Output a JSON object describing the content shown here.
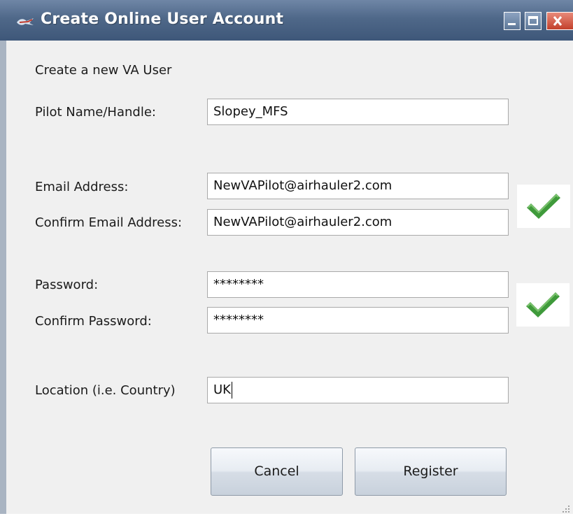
{
  "window": {
    "title": "Create Online User Account"
  },
  "form": {
    "heading": "Create a new VA User",
    "pilot_name": {
      "label": "Pilot Name/Handle:",
      "value": "Slopey_MFS"
    },
    "email": {
      "label": "Email Address:",
      "value": "NewVAPilot@airhauler2.com"
    },
    "confirm_email": {
      "label": "Confirm Email Address:",
      "value": "NewVAPilot@airhauler2.com"
    },
    "password": {
      "label": "Password:",
      "value": "********"
    },
    "confirm_password": {
      "label": "Confirm Password:",
      "value": "********"
    },
    "location": {
      "label": "Location (i.e. Country)",
      "value": "UK"
    }
  },
  "buttons": {
    "cancel": "Cancel",
    "register": "Register"
  },
  "colors": {
    "titlebar": "#4f6889",
    "check_green": "#3f9a3b",
    "window_bg": "#f0f0f0"
  },
  "icons": {
    "title": "app-plane-icon",
    "email_valid": "checkmark-icon",
    "password_valid": "checkmark-icon"
  }
}
